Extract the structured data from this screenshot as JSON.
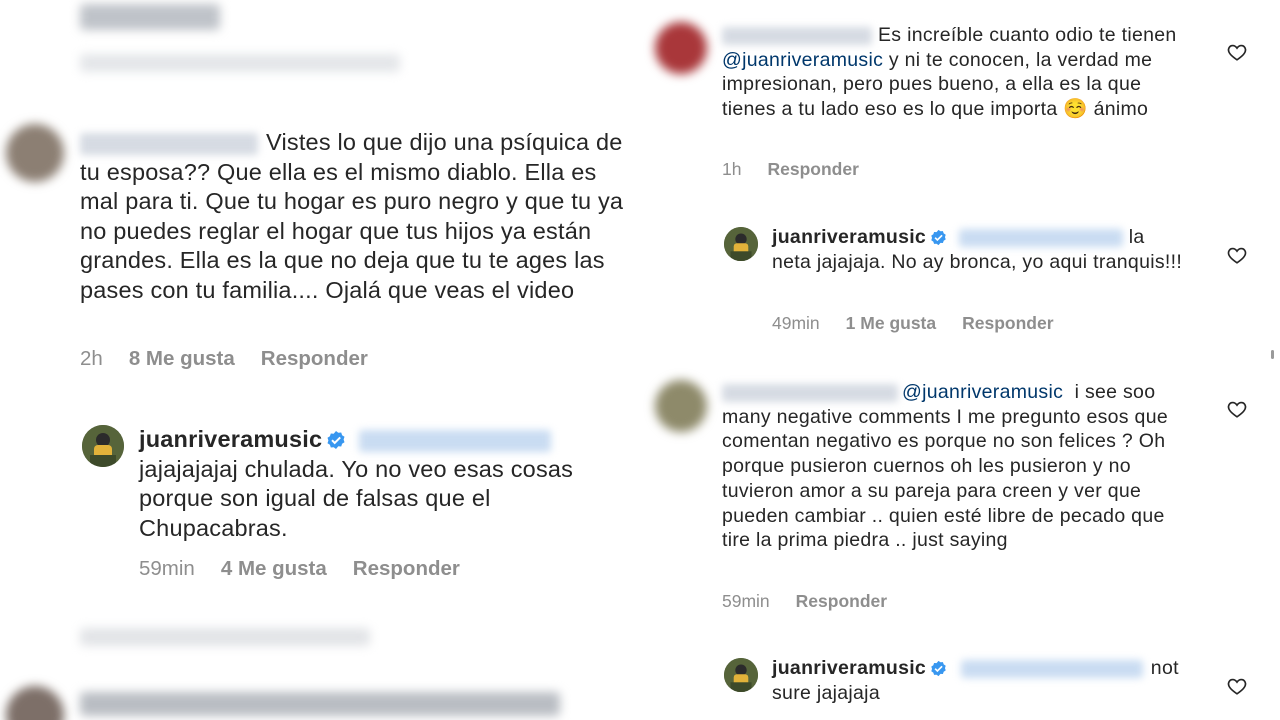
{
  "left": {
    "comment1": {
      "text": "Vistes lo que dijo una psíquica de tu esposa?? Que ella es el mismo diablo. Ella es mal para ti. Que tu hogar es puro negro y que tu ya no puedes reglar el hogar que tus hijos ya están grandes. Ella es la que no deja que tu te ages las pases con tu familia.... Ojalá que veas el video",
      "time": "2h",
      "likes": "8 Me gusta",
      "reply": "Responder"
    },
    "reply1": {
      "username": "juanriveramusic",
      "text": "jajajajajaj chulada. Yo no veo esas cosas porque son igual de falsas que el Chupacabras.",
      "time": "59min",
      "likes": "4 Me gusta",
      "reply": "Responder"
    }
  },
  "right": {
    "comment1": {
      "text_a": "Es increíble cuanto odio te tienen",
      "mention": "@juanriveramusic",
      "text_b": "y ni te conocen, la verdad me impresionan, pero pues bueno, a ella es la que tienes a tu lado eso es lo que importa",
      "emoji": "☺️",
      "text_c": "ánimo",
      "time": "1h",
      "reply": "Responder"
    },
    "reply1": {
      "username": "juanriveramusic",
      "text_a": "la",
      "text_b": "neta jajajaja. No ay bronca, yo aqui tranquis!!!",
      "time": "49min",
      "likes": "1 Me gusta",
      "reply": "Responder"
    },
    "comment2": {
      "mention": "@juanriveramusic",
      "text_a": "i see soo",
      "text_b": "many negative comments I me pregunto esos que comentan negativo es porque no son felices ? Oh porque pusieron cuernos oh les pusieron y no tuvieron amor a su pareja para creen y ver que pueden cambiar .. quien esté libre de pecado que tire la prima piedra .. just saying",
      "time": "59min",
      "reply": "Responder"
    },
    "reply2": {
      "username": "juanriveramusic",
      "text_a": "not",
      "text_b": "sure jajajaja"
    }
  },
  "colors": {
    "text": "#262626",
    "meta": "#8e8e8e",
    "mention": "#00376b",
    "verified": "#3897f0"
  }
}
